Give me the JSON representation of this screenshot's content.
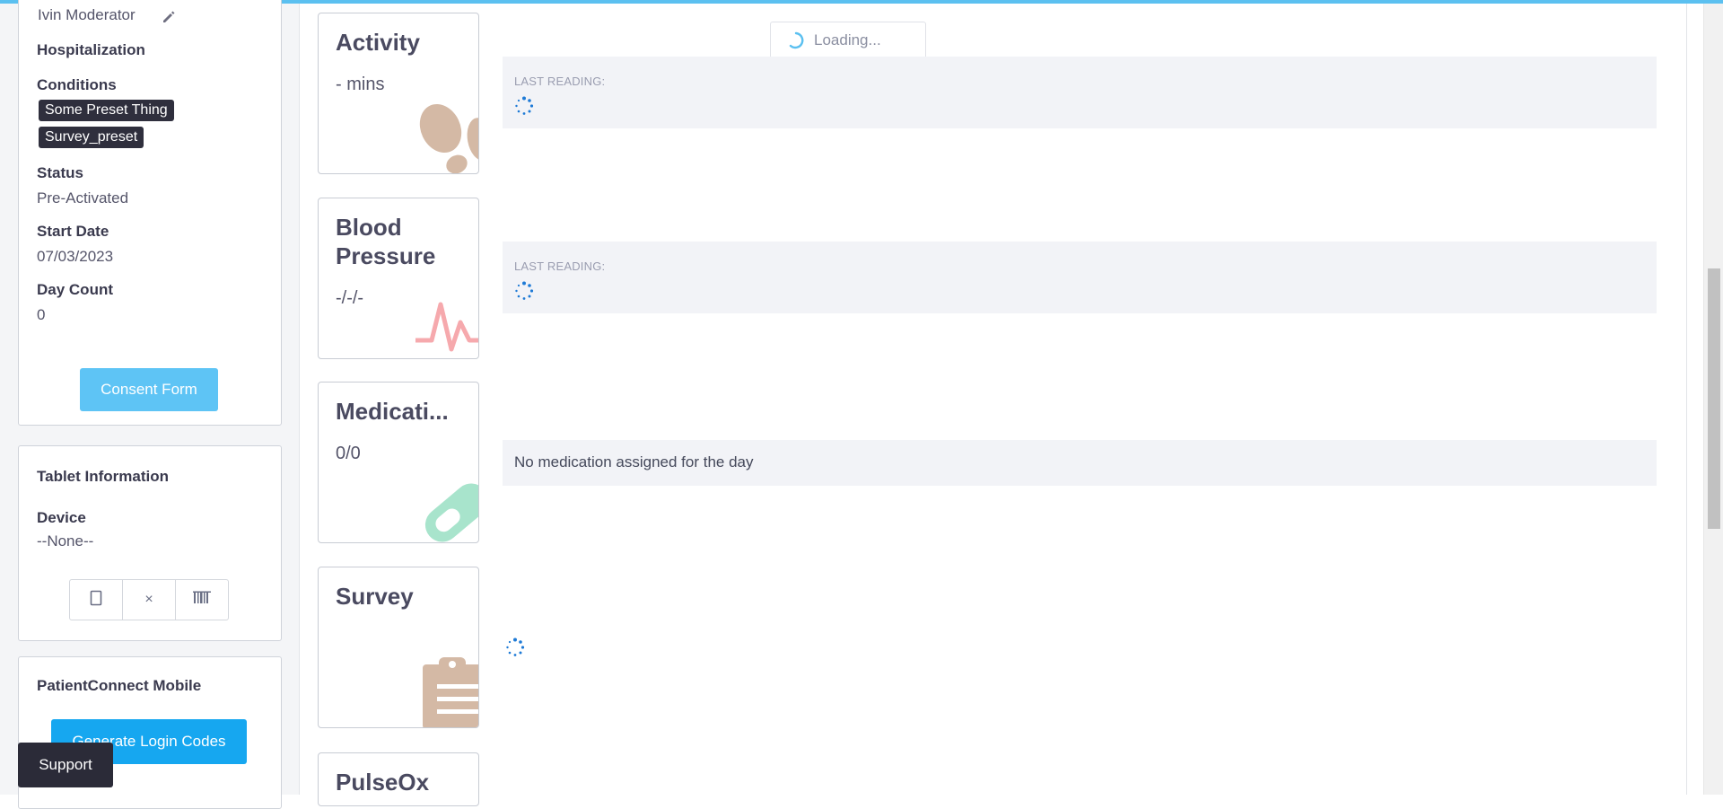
{
  "patient": {
    "moderator": "Ivin Moderator",
    "hospitalization_label": "Hospitalization",
    "conditions_label": "Conditions",
    "conditions": [
      "Some Preset Thing",
      "Survey_preset"
    ],
    "status_label": "Status",
    "status_value": "Pre-Activated",
    "start_date_label": "Start Date",
    "start_date_value": "07/03/2023",
    "day_count_label": "Day Count",
    "day_count_value": "0",
    "consent_button": "Consent Form"
  },
  "tablet": {
    "title": "Tablet Information",
    "device_label": "Device",
    "device_value": "--None--",
    "remove_symbol": "×"
  },
  "mobile": {
    "title": "PatientConnect Mobile",
    "generate_button": "Generate Login Codes"
  },
  "support_button": "Support",
  "loading_text": "Loading...",
  "vitals": {
    "activity": {
      "title": "Activity",
      "value": "- mins",
      "reading_label": "LAST READING:"
    },
    "blood_pressure": {
      "title": "Blood Pressure",
      "value": "-/-/-",
      "reading_label": "LAST READING:"
    },
    "medication": {
      "title": "Medicati...",
      "value": "0/0",
      "message": "No medication assigned for the day"
    },
    "survey": {
      "title": "Survey"
    },
    "pulseox": {
      "title": "PulseOx"
    }
  },
  "colors": {
    "accent": "#16a7f0",
    "consent_button": "#5ec4f5",
    "chip": "#2f2f3d",
    "activity_icon": "#d4b9a5",
    "bp_icon": "#f6a9ad",
    "medication_icon": "#a8e4cc",
    "survey_icon": "#d4b9a5",
    "spinner": "#1e7ad6"
  }
}
